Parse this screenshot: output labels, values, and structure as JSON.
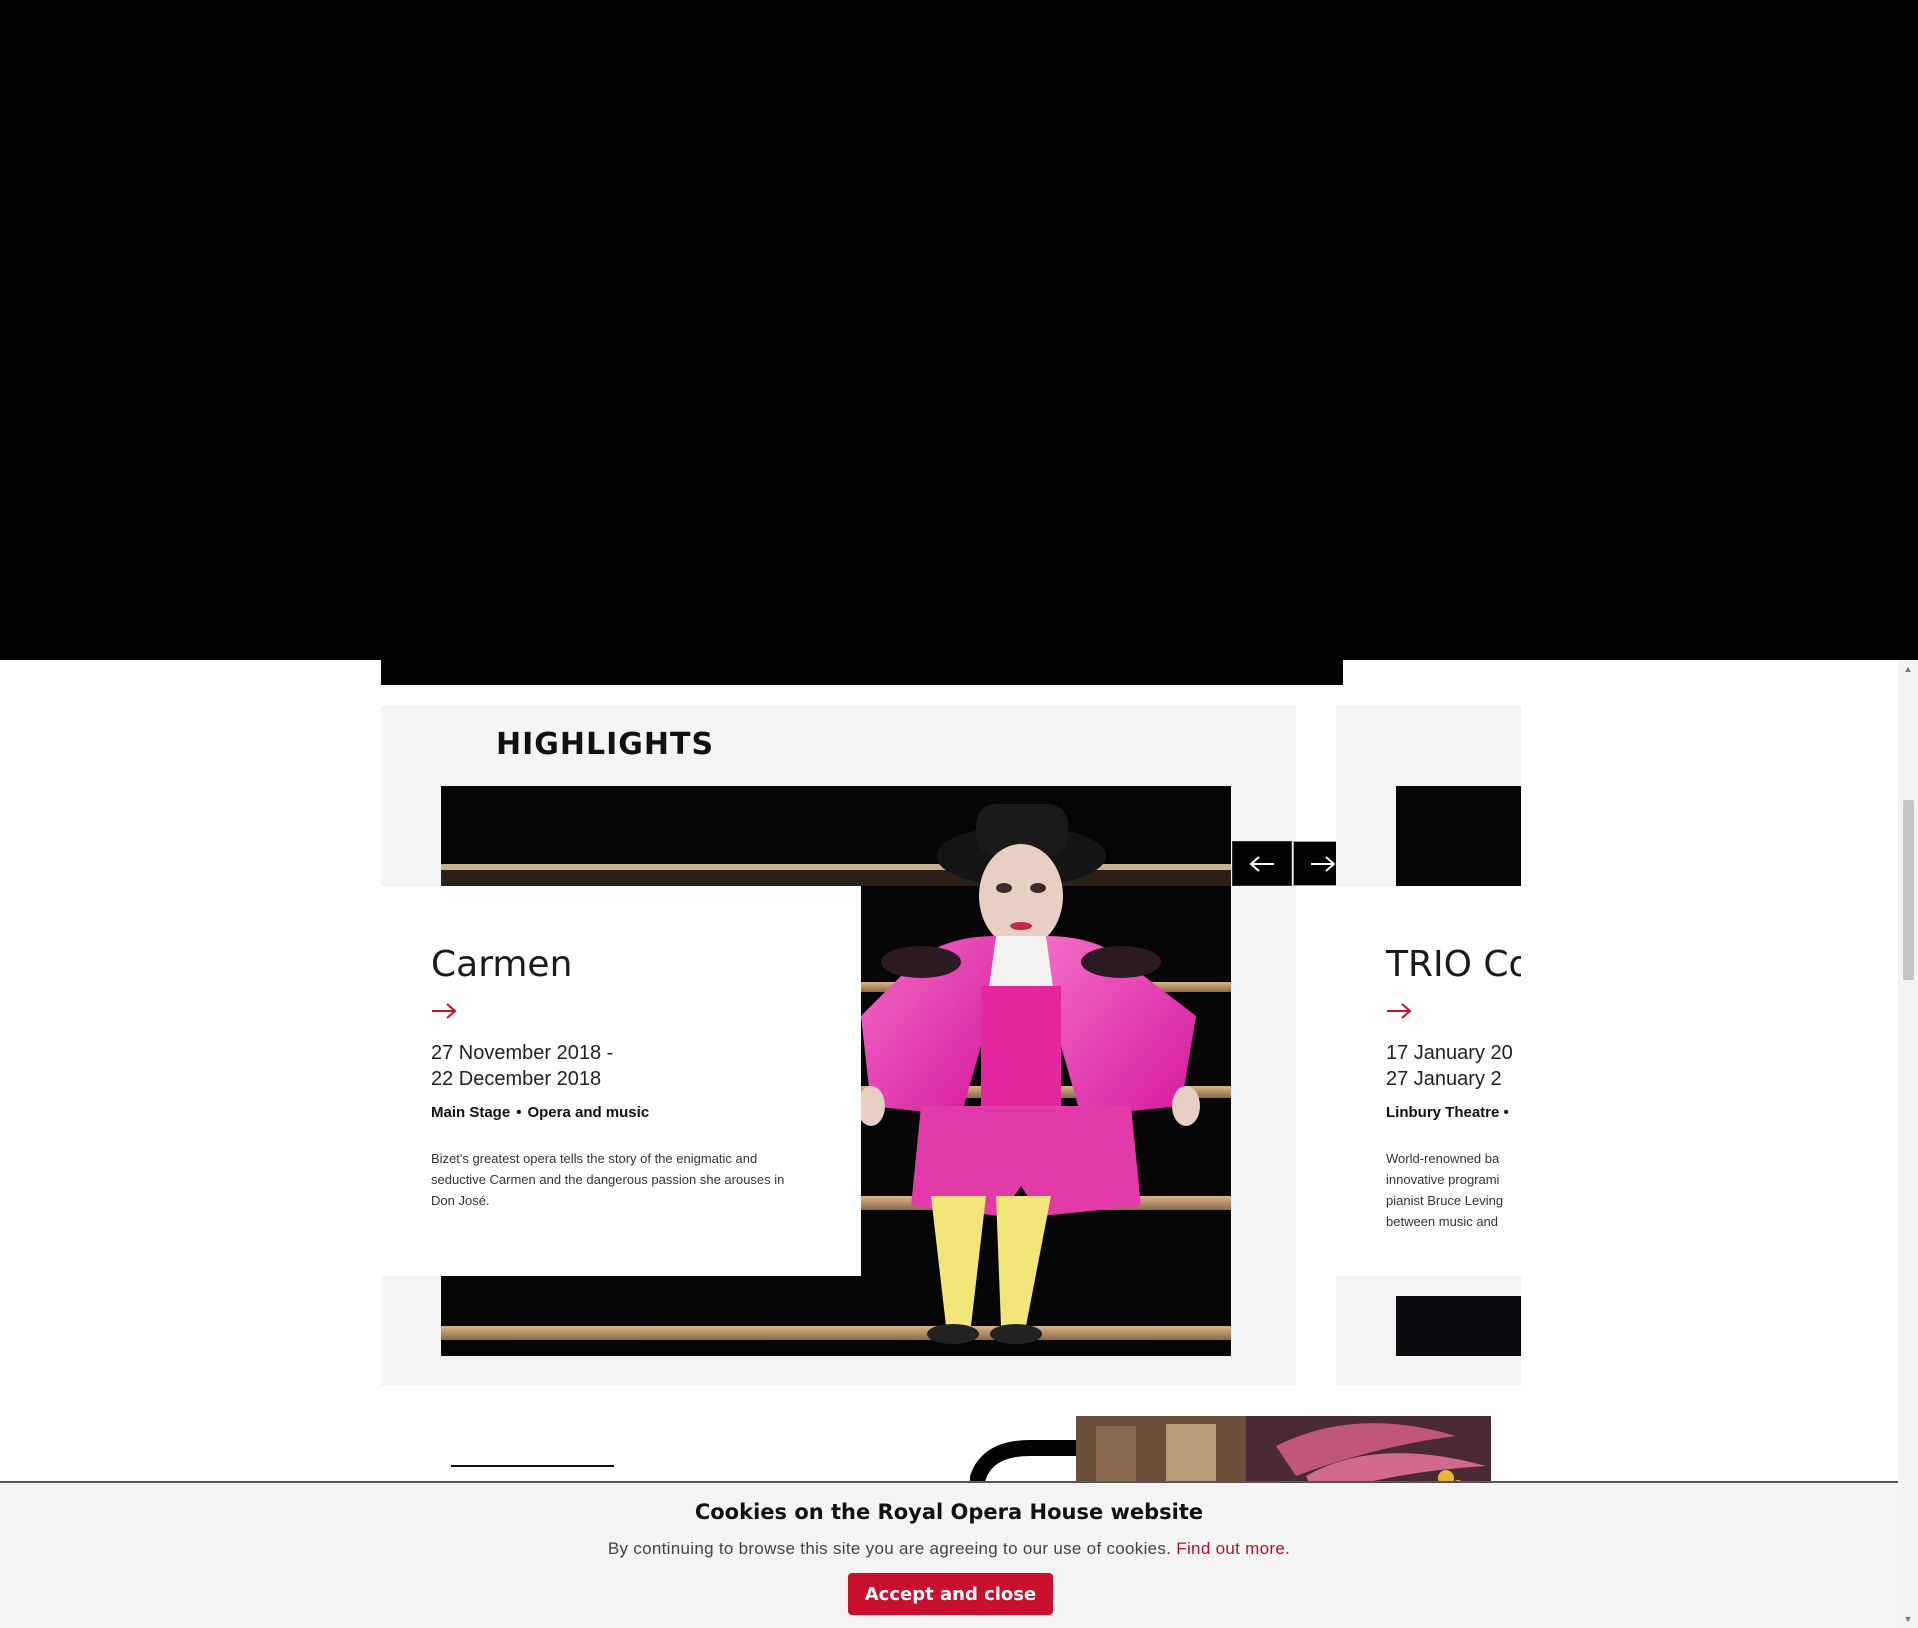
{
  "colors": {
    "accent": "#c8102e",
    "link": "#b0132a",
    "panel_bg": "#f4f4f4",
    "hero": "#000000"
  },
  "highlights": {
    "title": "HIGHLIGHTS",
    "nav": {
      "prev_icon": "arrow-left-icon",
      "next_icon": "arrow-right-icon"
    },
    "cards": [
      {
        "title": "Carmen",
        "arrow_icon": "arrow-right-icon",
        "date_start": "27 November 2018 -",
        "date_end": "22 December 2018",
        "venue": "Main Stage",
        "category": "Opera and music",
        "description": "Bizet's greatest opera tells the story of the enigmatic and seductive Carmen and the dangerous passion she arouses in Don José.",
        "image": "carmen-performer-pink-costume"
      },
      {
        "title": "TRIO Co",
        "arrow_icon": "arrow-right-icon",
        "date_start": "17 January 20",
        "date_end": "27 January 2",
        "venue": "Linbury Theatre",
        "category": "•",
        "description_lines": [
          "World-renowned ba",
          "innovative programi",
          "pianist Bruce Leving",
          "between music and"
        ]
      }
    ]
  },
  "cookie_banner": {
    "title": "Cookies on the Royal Opera House website",
    "text": "By continuing to browse this site you are agreeing to our use of cookies.",
    "link": "Find out more.",
    "button": "Accept and close"
  }
}
